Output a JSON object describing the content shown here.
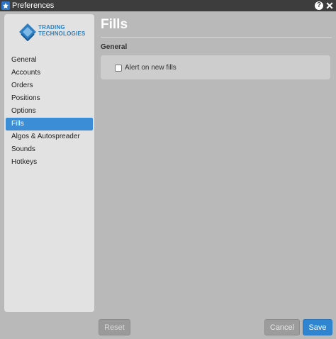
{
  "window": {
    "title": "Preferences"
  },
  "titlebar_icons": {
    "app": "app-logo-icon",
    "help": "help-icon",
    "close": "close-icon"
  },
  "logo": {
    "line1": "TRADING",
    "line2": "TECHNOLOGIES"
  },
  "sidebar": {
    "selected": "Fills",
    "items": [
      {
        "label": "General"
      },
      {
        "label": "Accounts"
      },
      {
        "label": "Orders"
      },
      {
        "label": "Positions"
      },
      {
        "label": "Options"
      },
      {
        "label": "Fills"
      },
      {
        "label": "Algos & Autospreader"
      },
      {
        "label": "Sounds"
      },
      {
        "label": "Hotkeys"
      }
    ]
  },
  "main": {
    "title": "Fills",
    "section": "General",
    "options": [
      {
        "label": "Alert on new fills",
        "checked": false
      }
    ]
  },
  "buttons": {
    "reset": "Reset",
    "cancel": "Cancel",
    "save": "Save"
  },
  "colors": {
    "accent": "#3b8ed6",
    "titlebar": "#3d3d3d",
    "sidebar": "#e2e2e2",
    "panel": "#b9b9b9"
  }
}
